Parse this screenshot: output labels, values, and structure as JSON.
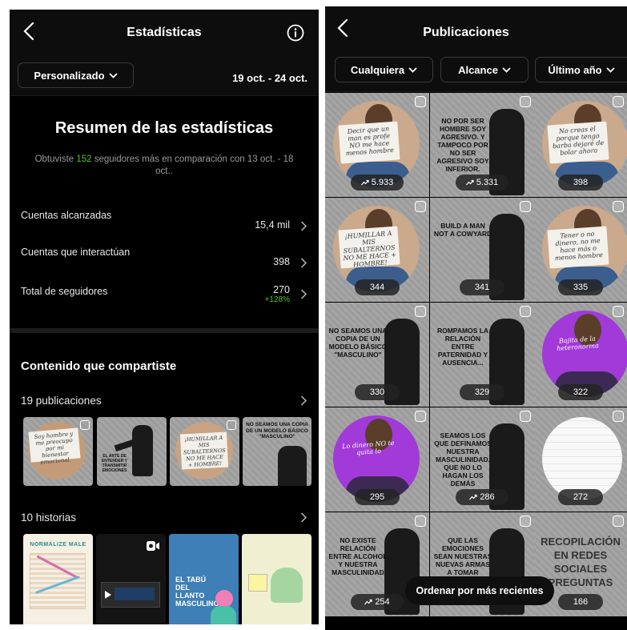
{
  "left": {
    "title": "Estadísticas",
    "period_filter": "Personalizado",
    "date_range": "19 oct. - 24 oct.",
    "summary_title": "Resumen de las estadísticas",
    "summary_prefix": "Obtuviste",
    "summary_count": "152",
    "summary_suffix": "seguidores más en comparación con 13 oct. - 18 oct..",
    "metrics": [
      {
        "label": "Cuentas alcanzadas",
        "value": "15,4 mil",
        "delta": ""
      },
      {
        "label": "Cuentas que interactúan",
        "value": "398",
        "delta": ""
      },
      {
        "label": "Total de seguidores",
        "value": "270",
        "delta": "+128%"
      }
    ],
    "content_title": "Contenido que compartiste",
    "posts_label": "19 publicaciones",
    "posts_thumbs": [
      {
        "text": "Soy hombre y me preocupo por mi bienestar emocional."
      },
      {
        "text": "EL ARTE DE ENTENDER Y TRANSMITIR EMOCIONES"
      },
      {
        "text": "¡HUMILLAR A MIS SUBALTERNOS NO ME HACE + HOMBRE!"
      },
      {
        "text": "NO SEAMOS UNA COPIA DE UN MODELO BÁSICO \"MASCULINO\""
      }
    ],
    "stories_label": "10 historias",
    "stories_thumbs": [
      {
        "text": "NORMALIZE MALE"
      },
      {
        "text": ""
      },
      {
        "text": "EL TABÚ DEL LLANTO MASCULINO"
      },
      {
        "text": ""
      }
    ],
    "accent_green": "#58c322"
  },
  "right": {
    "title": "Publicaciones",
    "filters": [
      "Cualquiera",
      "Alcance",
      "Último año"
    ],
    "tiles": [
      {
        "kind": "photo",
        "text": "Decir que un man es profe NO me hace menos hombre",
        "count": "5.933",
        "trend": true
      },
      {
        "kind": "poster",
        "text": "NO POR SER HOMBRE SOY AGRESIVO. Y TAMPOCO POR NO SER AGRESIVO SOY INFERIOR.",
        "count": "5.331",
        "trend": true
      },
      {
        "kind": "photo",
        "text": "No creas el porque tengo barba dejaré de bolar ahora",
        "count": "398",
        "trend": false
      },
      {
        "kind": "photo",
        "text": "¡HUMILLAR A MIS SUBALTERNOS NO ME HACE + HOMBRE!",
        "count": "344",
        "trend": false
      },
      {
        "kind": "poster",
        "text": "BUILD A MAN NOT A COWYARD",
        "count": "341",
        "trend": false
      },
      {
        "kind": "photo",
        "text": "Tener o no dinero, no me hace más o menos hombre",
        "count": "335",
        "trend": false
      },
      {
        "kind": "poster",
        "text": "NO SEAMOS UNA COPIA DE UN MODELO BÁSICO \"MASCULINO\"",
        "count": "330",
        "trend": false
      },
      {
        "kind": "poster",
        "text": "ROMPAMOS LA RELACIÓN ENTRE PATERNIDAD Y AUSENCIA...",
        "count": "329",
        "trend": false
      },
      {
        "kind": "photo-purple",
        "text": "Bajita de la heteronorma",
        "count": "322",
        "trend": false
      },
      {
        "kind": "photo-purple",
        "text": "Lo dinero NO te quita lo",
        "count": "295",
        "trend": false
      },
      {
        "kind": "poster",
        "text": "SEAMOS LOS QUE DEFINAMOS NUESTRA MASCULINIDAD. QUE NO LO HAGAN LOS DEMÁS",
        "count": "286",
        "trend": true
      },
      {
        "kind": "notebook",
        "text": "",
        "count": "272",
        "trend": false
      },
      {
        "kind": "poster",
        "text": "NO EXISTE RELACIÓN ENTRE ALCOHOL Y NUESTRA MASCULINIDAD",
        "count": "254",
        "trend": true
      },
      {
        "kind": "poster",
        "text": "QUE LAS EMOCIONES SEAN NUESTRAS NUEVAS ARMAS A TOMAR",
        "count": "",
        "trend": false
      },
      {
        "kind": "poster-text",
        "text": "RECOPILACIÓN EN REDES SOCIALES PREGUNTAS",
        "count": "166",
        "trend": false
      }
    ],
    "sort_button": "Ordenar por más recientes",
    "colors": {
      "bg": "#000000",
      "tile_gray": "#a4a4a4",
      "purple": "#a13ad8"
    }
  }
}
